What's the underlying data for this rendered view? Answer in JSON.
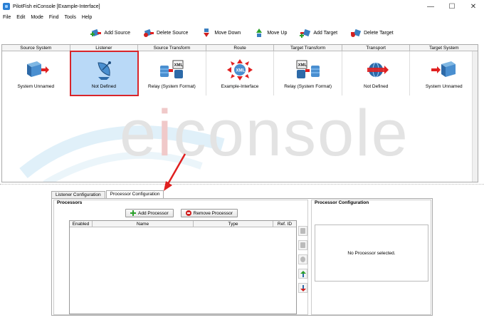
{
  "window": {
    "title": "PilotFish eiConsole [Example-Interface]",
    "controls": [
      "—",
      "☐",
      "✕"
    ]
  },
  "menu": [
    {
      "label": "File",
      "key": "F"
    },
    {
      "label": "Edit",
      "key": "E"
    },
    {
      "label": "Mode",
      "key": "M"
    },
    {
      "label": "Find",
      "key": "F"
    },
    {
      "label": "Tools",
      "key": "T"
    },
    {
      "label": "Help",
      "key": "H"
    }
  ],
  "toolbar": {
    "add_source": "Add Source",
    "delete_source": "Delete Source",
    "move_down": "Move Down",
    "move_up": "Move Up",
    "add_target": "Add Target",
    "delete_target": "Delete Target"
  },
  "stages": {
    "headers": [
      "Source System",
      "Listener",
      "Source Transform",
      "Route",
      "Target Transform",
      "Transport",
      "Target System"
    ],
    "cells": [
      "System Unnamed",
      "Not Defined",
      "Relay (System Format)",
      "Example-Interface",
      "Relay (System Format)",
      "Not Defined",
      "System Unnamed"
    ],
    "icons": [
      "system-icon",
      "listener-dish-icon",
      "xml-relay-icon",
      "route-xml-icon",
      "xml-relay-icon",
      "transport-globe-icon",
      "system-icon"
    ],
    "selected_index": 1
  },
  "watermark": {
    "text_left": "e",
    "text_i": "i",
    "text_right": "console"
  },
  "tabs": [
    {
      "label": "Listener Configuration"
    },
    {
      "label": "Processor Configuration",
      "active": true
    }
  ],
  "processors": {
    "title": "Processors",
    "add_button": "Add Processor",
    "remove_button": "Remove Processor",
    "columns": [
      "Enabled",
      "Name",
      "Type",
      "Ref. ID"
    ]
  },
  "processor_config": {
    "title": "Processor Configuration",
    "empty_message": "No Processor selected."
  },
  "colors": {
    "selection_bg": "#b9d9f7",
    "highlight_border": "#d9252a",
    "accent_blue": "#2a7fd4",
    "arrow_red": "#e02020"
  }
}
